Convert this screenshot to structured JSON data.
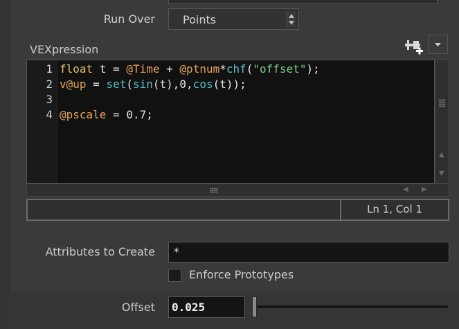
{
  "run_over": {
    "label": "Run Over",
    "value": "Points"
  },
  "vexpression": {
    "label": "VEXpression",
    "line_numbers": [
      "1",
      "2",
      "3",
      "4"
    ],
    "lines": [
      [
        {
          "t": "float",
          "c": "kw"
        },
        {
          "t": " t = ",
          "c": ""
        },
        {
          "t": "@Time",
          "c": "attr"
        },
        {
          "t": " + ",
          "c": ""
        },
        {
          "t": "@ptnum",
          "c": "attr"
        },
        {
          "t": "*",
          "c": ""
        },
        {
          "t": "chf",
          "c": "fn"
        },
        {
          "t": "(",
          "c": ""
        },
        {
          "t": "\"offset\"",
          "c": "str"
        },
        {
          "t": ");",
          "c": ""
        }
      ],
      [
        {
          "t": "v@up",
          "c": "attr"
        },
        {
          "t": " = ",
          "c": ""
        },
        {
          "t": "set",
          "c": "fn"
        },
        {
          "t": "(",
          "c": ""
        },
        {
          "t": "sin",
          "c": "fn"
        },
        {
          "t": "(t),0,",
          "c": ""
        },
        {
          "t": "cos",
          "c": "fn"
        },
        {
          "t": "(t));",
          "c": ""
        }
      ],
      [],
      [
        {
          "t": "@pscale",
          "c": "attr"
        },
        {
          "t": " = 0.7;",
          "c": ""
        }
      ]
    ],
    "cursor_status": "Ln 1, Col 1"
  },
  "attributes_to_create": {
    "label": "Attributes to Create",
    "value": "*"
  },
  "enforce_prototypes": {
    "label": "Enforce Prototypes",
    "checked": false
  },
  "offset": {
    "label": "Offset",
    "value": "0.025",
    "slider_fraction": 0.0
  },
  "icons": {
    "add_parm": "plus-parameter-icon",
    "menu": "dropdown-arrow-icon",
    "combo": "updown-arrows-icon"
  }
}
